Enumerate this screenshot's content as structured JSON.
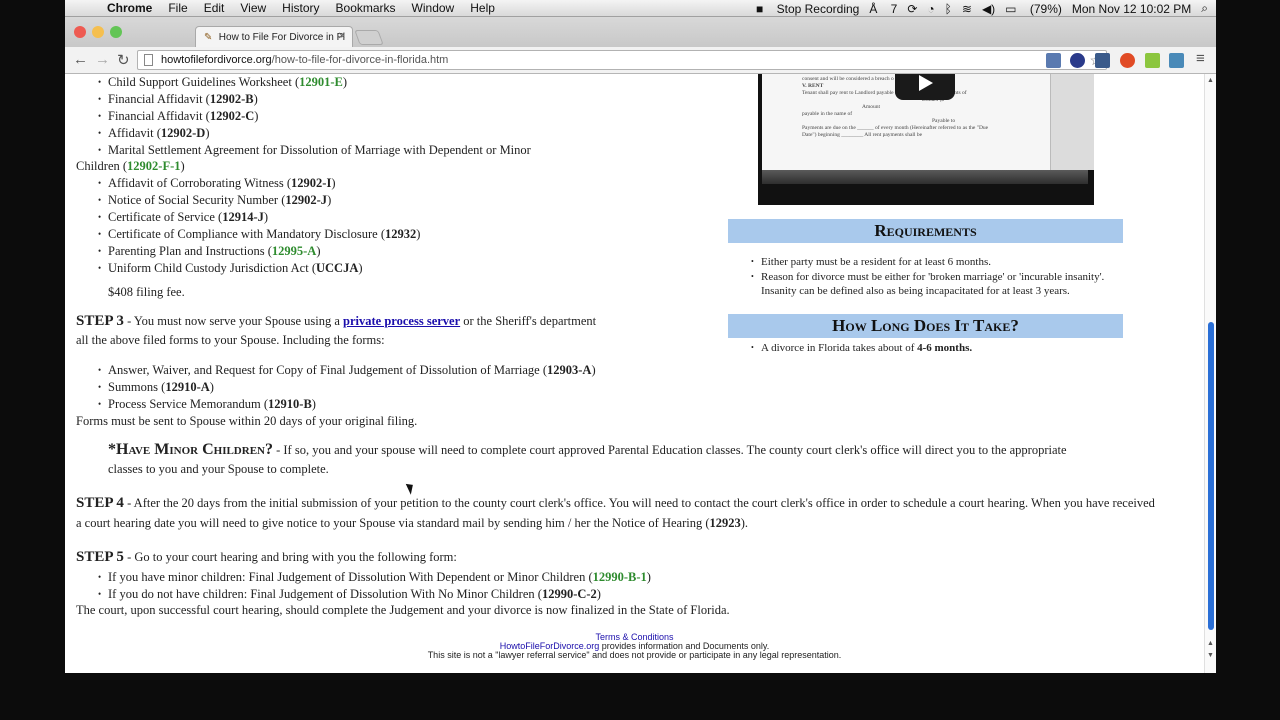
{
  "menubar": {
    "app": "Chrome",
    "items": [
      "File",
      "Edit",
      "View",
      "History",
      "Bookmarks",
      "Window",
      "Help"
    ],
    "stop_recording": "Stop Recording",
    "adobe_count": "7",
    "battery": "(79%)",
    "clock": "Mon Nov 12  10:02 PM"
  },
  "browser": {
    "tab_title": "How to File For Divorce in Fl",
    "url_domain": "howtofilefordivorce.org",
    "url_path": "/how-to-file-for-divorce-in-florida.htm"
  },
  "content": {
    "list1": [
      {
        "t": "Child Support Guidelines Worksheet (",
        "c": "12901-E",
        "e": ")",
        "green": true
      },
      {
        "t": "Financial Affidavit (",
        "c": "12902-B",
        "e": ")",
        "green": false
      },
      {
        "t": "Financial Affidavit (",
        "c": "12902-C",
        "e": ")",
        "green": false
      },
      {
        "t": "Affidavit (",
        "c": "12902-D",
        "e": ")",
        "green": false
      },
      {
        "t": "Marital Settlement Agreement for Dissolution of Marriage with Dependent or Minor",
        "c": "",
        "e": "",
        "green": false
      }
    ],
    "children_line": "Children (",
    "children_code": "12902-F-1",
    "children_end": ")",
    "list2": [
      {
        "t": "Affidavit of Corroborating Witness (",
        "c": "12902-I",
        "e": ")",
        "green": false
      },
      {
        "t": "Notice of Social Security Number (",
        "c": "12902-J",
        "e": ")",
        "green": false
      },
      {
        "t": "Certificate of Service (",
        "c": "12914-J",
        "e": ")",
        "green": false
      },
      {
        "t": "Certificate of Compliance with Mandatory Disclosure (",
        "c": "12932",
        "e": ")",
        "green": false
      },
      {
        "t": "Parenting Plan and Instructions (",
        "c": "12995-A",
        "e": ")",
        "green": true
      },
      {
        "t": "Uniform Child Custody Jurisdiction Act (",
        "c": "UCCJA",
        "e": ")",
        "green": false
      }
    ],
    "filing_fee": "$408 filing fee.",
    "step3_label": "STEP 3",
    "step3_text1": " - You must now serve your Spouse using a ",
    "step3_link": "private process server",
    "step3_text2": " or the Sheriff's department",
    "step3_line2": "all the above filed forms to your Spouse. Including the forms:",
    "list3": [
      {
        "t": "Answer, Waiver, and Request for Copy of Final Judgement of Dissolution of Marriage (",
        "c": "12903-A",
        "e": ")",
        "green": false
      },
      {
        "t": "Summons (",
        "c": "12910-A",
        "e": ")",
        "green": false
      },
      {
        "t": "Process Service Memorandum (",
        "c": "12910-B",
        "e": ")",
        "green": false
      }
    ],
    "forms_note": "Forms must be sent to Spouse within 20 days of your original filing.",
    "minor_heading": "*Have Minor Children?",
    "minor_text1": " - If so, you and your spouse will need to complete court approved Parental Education classes. The county court clerk's office will direct you to the appropriate",
    "minor_text2": "classes to you and your Spouse to complete.",
    "step4_label": "STEP 4",
    "step4_text1": " - After the 20 days from the initial submission of your petition to the county court clerk's office. You will need to contact the court clerk's office in order to schedule a court hearing. When you have received",
    "step4_text2": "a court hearing date you will need to give notice to your Spouse via standard mail by sending him / her the Notice of Hearing (",
    "step4_code": "12923",
    "step4_end": ").",
    "step5_label": "STEP 5",
    "step5_text": " - Go to your court hearing and bring with you the following form:",
    "list4": [
      {
        "t": "If you have minor children: Final Judgement of Dissolution With Dependent or Minor Children (",
        "c": "12990-B-1",
        "e": ")",
        "green": true
      },
      {
        "t": "If you do not have children: Final Judgement of Dissolution With No Minor Children (",
        "c": "12990-C-2",
        "e": ")",
        "green": false
      }
    ],
    "final_line": "The court, upon successful court hearing, should complete the Judgement and your divorce is now finalized in the State of Florida."
  },
  "sidebar": {
    "video_doc_lines": [
      "consent and will be considered a breach o",
      "V. RENT",
      "Tenant shall pay rent to Landlord payable to in the monthly installments of",
      "Dollars ($",
      "Amount",
      "payable in the name of",
      "Payable to",
      "Payments are due on the ______ of every month (Hereinafter referred to as the \"Due",
      "Date\") beginning ________ All rent payments shall be"
    ],
    "requirements_heading": "Requirements",
    "requirements": [
      "Either party must be a resident for at least 6 months.",
      "Reason for divorce must be either for 'broken marriage' or 'incurable insanity'. Insanity can be defined also as being incapacitated for at least 3 years."
    ],
    "howlong_heading": "How Long Does It Take?",
    "howlong_text": "A divorce in Florida takes about of ",
    "howlong_bold": "4-6 months."
  },
  "footer": {
    "terms": "Terms & Conditions",
    "site": "HowtoFileForDivorce.org",
    "line1_rest": " provides information and Documents only.",
    "line2": "This site is not a \"lawyer referral service\" and does not provide or participate in any legal representation."
  }
}
